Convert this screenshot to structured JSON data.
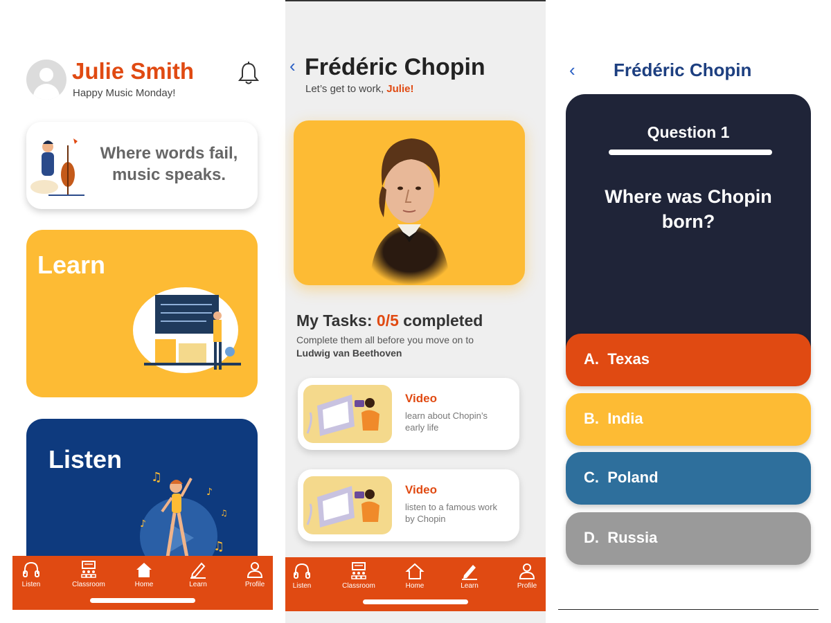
{
  "home": {
    "user_name": "Julie Smith",
    "greeting": "Happy Music Monday!",
    "quote_line1": "Where words fail,",
    "quote_line2": "music speaks.",
    "learn_label": "Learn",
    "listen_label": "Listen"
  },
  "tabs": [
    {
      "label": "Listen",
      "icon": "headphones-icon"
    },
    {
      "label": "Classroom",
      "icon": "classroom-icon"
    },
    {
      "label": "Home",
      "icon": "home-icon"
    },
    {
      "label": "Learn",
      "icon": "pencil-icon"
    },
    {
      "label": "Profile",
      "icon": "profile-icon"
    }
  ],
  "composer": {
    "back_label": "‹",
    "title": "Frédéric Chopin",
    "subtitle_prefix": "Let’s get to work, ",
    "subtitle_name": "Julie!",
    "tasks_prefix": "My Tasks: ",
    "tasks_count": "0/5",
    "tasks_suffix": " completed",
    "tasks_desc": "Complete them all before you move on to",
    "next_composer": "Ludwig van Beethoven",
    "tasks": [
      {
        "type": "Video",
        "desc": "learn about Chopin’s early life"
      },
      {
        "type": "Video",
        "desc": "listen to a famous work by Chopin"
      }
    ]
  },
  "quiz": {
    "back_label": "‹",
    "title": "Frédéric Chopin",
    "question_number": "Question 1",
    "question": "Where was Chopin born?",
    "answers": [
      {
        "label": "A.  Texas",
        "color": "#e04a12"
      },
      {
        "label": "B.  India",
        "color": "#fdbb34"
      },
      {
        "label": "C.  Poland",
        "color": "#2e6f9c"
      },
      {
        "label": "D.  Russia",
        "color": "#9a9a9a"
      }
    ]
  },
  "colors": {
    "brand_orange": "#e04a12",
    "brand_yellow": "#fdbb34",
    "brand_navy": "#0e3a7e",
    "quiz_dark": "#1f2438"
  }
}
